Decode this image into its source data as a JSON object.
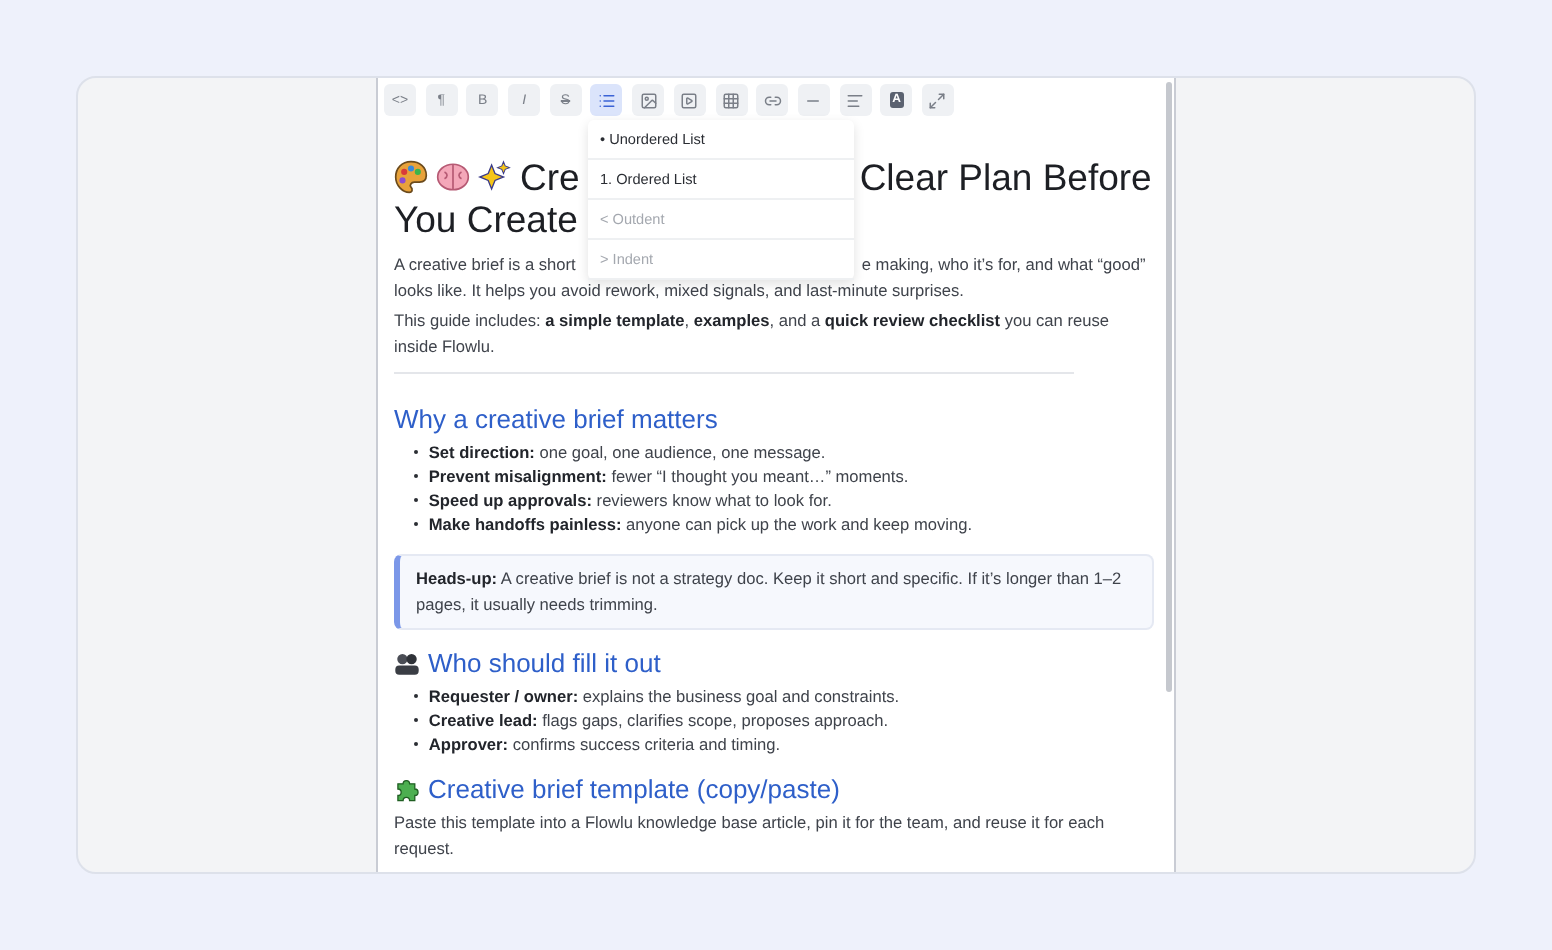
{
  "toolbar": {
    "buttons": [
      {
        "kind": "glyph",
        "label": "<>",
        "selected": false
      },
      {
        "kind": "glyph",
        "label": "¶",
        "selected": false
      },
      {
        "kind": "glyph",
        "label": "B",
        "selected": false
      },
      {
        "kind": "glyph",
        "label": "I",
        "selected": false
      },
      {
        "kind": "glyph",
        "label": "S",
        "selected": false
      },
      {
        "kind": "list",
        "selected": true
      },
      {
        "kind": "image",
        "selected": false
      },
      {
        "kind": "video",
        "selected": false
      },
      {
        "kind": "table",
        "selected": false
      },
      {
        "kind": "link",
        "selected": false
      },
      {
        "kind": "rule",
        "selected": false
      },
      {
        "kind": "align",
        "selected": false
      },
      {
        "kind": "badge",
        "label": "A",
        "selected": false
      },
      {
        "kind": "expand",
        "selected": false
      }
    ]
  },
  "dropdown": {
    "items": [
      {
        "label": "• Unordered List",
        "disabled": false
      },
      {
        "label": "1. Ordered List",
        "disabled": false
      },
      {
        "label": "< Outdent",
        "disabled": true
      },
      {
        "label": "> Indent",
        "disabled": true
      }
    ]
  },
  "document": [
    {
      "kind": "title",
      "lines": [
        [
          "Cre",
          "Clear Plan Before"
        ],
        [
          "You Create"
        ]
      ]
    },
    {
      "kind": "split-paragraph",
      "lines": [
        [
          "A creative brief is a short",
          "e making, who it’s for, and what “good”"
        ],
        [
          "looks like. It helps you avoid rework, mixed signals, and last-minute surprises."
        ]
      ]
    },
    {
      "kind": "paragraph",
      "text": "This guide includes: **a simple template**, **examples**, and a **quick review checklist** you can reuse inside Flowlu."
    },
    {
      "kind": "rule"
    },
    {
      "kind": "heading",
      "text": "Why a creative brief matters"
    },
    {
      "kind": "bullets",
      "items": [
        "**Set direction:** one goal, one audience, one message.",
        "**Prevent misalignment:** fewer “I thought you meant…” moments.",
        "**Speed up approvals:** reviewers know what to look for.",
        "**Make handoffs painless:** anyone can pick up the work and keep moving."
      ]
    },
    {
      "kind": "callout",
      "text": "**Heads-up:** A creative brief is not a strategy doc. Keep it short and specific. If it’s longer than 1–2 pages, it usually needs trimming."
    },
    {
      "kind": "heading",
      "text": "Who should fill it out"
    },
    {
      "kind": "bullets",
      "items": [
        "**Requester / owner:** explains the business goal and constraints.",
        "**Creative lead:** flags gaps, clarifies scope, proposes approach.",
        "**Approver:** confirms success criteria and timing."
      ]
    },
    {
      "kind": "heading",
      "text": "Creative brief template (copy/paste)"
    },
    {
      "kind": "paragraph",
      "text": "Paste this template into a Flowlu knowledge base article, pin it for the team, and reuse it for each request."
    }
  ]
}
